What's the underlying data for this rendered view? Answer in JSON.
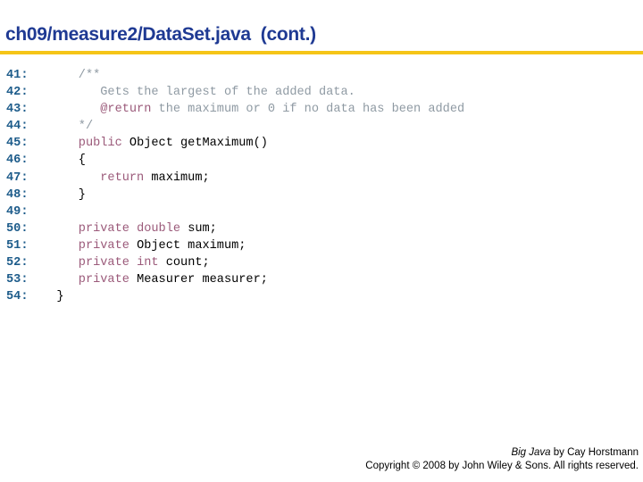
{
  "title": "ch09/measure2/DataSet.java  (cont.)",
  "accent_color": "#f5c518",
  "code_lines": [
    {
      "num": "41:",
      "segments": [
        {
          "t": "     ",
          "c": "tx"
        },
        {
          "t": "/**",
          "c": "cm"
        }
      ]
    },
    {
      "num": "42:",
      "segments": [
        {
          "t": "        ",
          "c": "tx"
        },
        {
          "t": "Gets the largest of the added data.",
          "c": "cm"
        }
      ]
    },
    {
      "num": "43:",
      "segments": [
        {
          "t": "        ",
          "c": "tx"
        },
        {
          "t": "@return",
          "c": "kw"
        },
        {
          "t": " the maximum or 0 if no data has been added",
          "c": "cm"
        }
      ]
    },
    {
      "num": "44:",
      "segments": [
        {
          "t": "     ",
          "c": "tx"
        },
        {
          "t": "*/",
          "c": "cm"
        }
      ]
    },
    {
      "num": "45:",
      "segments": [
        {
          "t": "     ",
          "c": "tx"
        },
        {
          "t": "public",
          "c": "kw"
        },
        {
          "t": " Object getMaximum()",
          "c": "tx"
        }
      ]
    },
    {
      "num": "46:",
      "segments": [
        {
          "t": "     ",
          "c": "tx"
        },
        {
          "t": "{",
          "c": "tx"
        }
      ]
    },
    {
      "num": "47:",
      "segments": [
        {
          "t": "        ",
          "c": "tx"
        },
        {
          "t": "return",
          "c": "kw"
        },
        {
          "t": " maximum;",
          "c": "tx"
        }
      ]
    },
    {
      "num": "48:",
      "segments": [
        {
          "t": "     ",
          "c": "tx"
        },
        {
          "t": "}",
          "c": "tx"
        }
      ]
    },
    {
      "num": "49:",
      "segments": []
    },
    {
      "num": "50:",
      "segments": [
        {
          "t": "     ",
          "c": "tx"
        },
        {
          "t": "private",
          "c": "kw"
        },
        {
          "t": " ",
          "c": "tx"
        },
        {
          "t": "double",
          "c": "kw"
        },
        {
          "t": " sum;",
          "c": "tx"
        }
      ]
    },
    {
      "num": "51:",
      "segments": [
        {
          "t": "     ",
          "c": "tx"
        },
        {
          "t": "private",
          "c": "kw"
        },
        {
          "t": " Object maximum;",
          "c": "tx"
        }
      ]
    },
    {
      "num": "52:",
      "segments": [
        {
          "t": "     ",
          "c": "tx"
        },
        {
          "t": "private",
          "c": "kw"
        },
        {
          "t": " ",
          "c": "tx"
        },
        {
          "t": "int",
          "c": "kw"
        },
        {
          "t": " count;",
          "c": "tx"
        }
      ]
    },
    {
      "num": "53:",
      "segments": [
        {
          "t": "     ",
          "c": "tx"
        },
        {
          "t": "private",
          "c": "kw"
        },
        {
          "t": " Measurer measurer;",
          "c": "tx"
        }
      ]
    },
    {
      "num": "54:",
      "segments": [
        {
          "t": "  ",
          "c": "tx"
        },
        {
          "t": "}",
          "c": "tx"
        }
      ]
    }
  ],
  "footer": {
    "book_title": "Big Java",
    "author": " by Cay Horstmann",
    "copyright": "Copyright © 2008 by John Wiley & Sons.  All rights reserved."
  }
}
